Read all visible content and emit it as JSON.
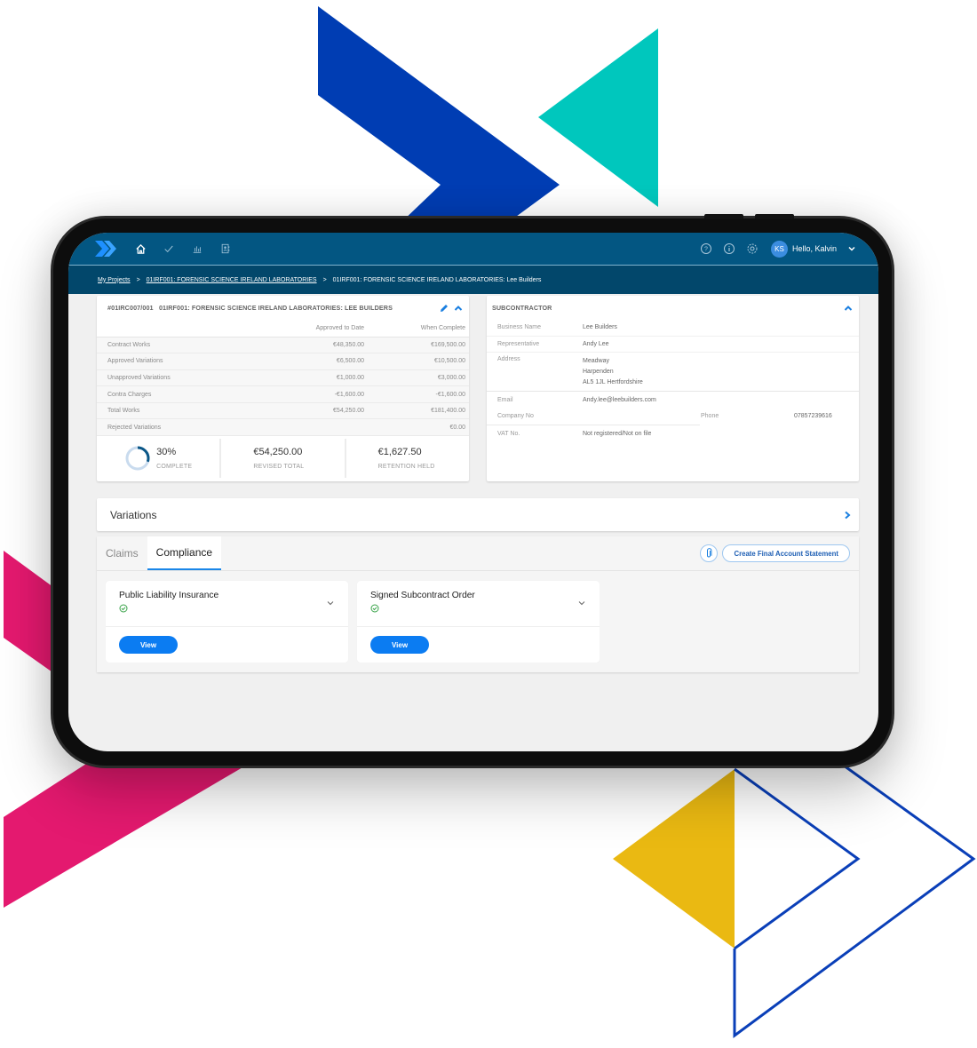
{
  "colors": {
    "topbar": "#035682",
    "breadcrumb_bg": "#02476b",
    "accent": "#1a86e8",
    "button": "#0b7cf2",
    "success": "#3aa44a",
    "deco_blue": "#003db3",
    "deco_teal": "#00c7bd",
    "deco_pink": "#e4196f",
    "deco_yellow": "#eab912"
  },
  "topbar": {
    "logo": "double-chevron-logo",
    "nav_icons": [
      "home-icon",
      "check-icon",
      "bar-chart-icon",
      "contacts-icon"
    ],
    "right_icons": [
      "help-icon",
      "info-icon",
      "settings-icon"
    ],
    "avatar_initials": "KS",
    "greeting": "Hello, Kalvin"
  },
  "breadcrumb": {
    "items": [
      "My Projects",
      "01IRF001: FORENSIC SCIENCE IRELAND LABORATORIES",
      "01IRF001: FORENSIC SCIENCE IRELAND LABORATORIES: Lee Builders"
    ],
    "separator": ">"
  },
  "contract": {
    "title": "#01IRC007/001   01IRF001: FORENSIC SCIENCE IRELAND LABORATORIES: LEE BUILDERS",
    "columns": [
      "",
      "Approved to Date",
      "When Complete"
    ],
    "rows": [
      {
        "label": "Contract Works",
        "approved": "€48,350.00",
        "complete": "€169,500.00"
      },
      {
        "label": "Approved Variations",
        "approved": "€6,500.00",
        "complete": "€10,500.00"
      },
      {
        "label": "Unapproved Variations",
        "approved": "€1,000.00",
        "complete": "€3,000.00"
      },
      {
        "label": "Contra Charges",
        "approved": "-€1,600.00",
        "complete": "-€1,600.00"
      },
      {
        "label": "Total Works",
        "approved": "€54,250.00",
        "complete": "€181,400.00"
      },
      {
        "label": "Rejected Variations",
        "approved": "",
        "complete": "€0.00"
      }
    ],
    "stats": {
      "complete_percent": 30,
      "complete_label": "30%",
      "complete_caption": "COMPLETE",
      "revised_total": "€54,250.00",
      "revised_caption": "REVISED TOTAL",
      "retention": "€1,627.50",
      "retention_caption": "RETENTION HELD"
    }
  },
  "subcontractor": {
    "title": "SUBCONTRACTOR",
    "business_name_label": "Business Name",
    "business_name": "Lee Builders",
    "representative_label": "Representative",
    "representative": "Andy Lee",
    "address_label": "Address",
    "address": [
      "Meadway",
      "Harpenden",
      "AL5 1JL Hertfordshire"
    ],
    "email_label": "Email",
    "email": "Andy.lee@leebuilders.com",
    "company_no_label": "Company No",
    "company_no": "",
    "phone_label": "Phone",
    "phone": "07857239616",
    "vat_label": "VAT No.",
    "vat": "Not registered/Not on file"
  },
  "variations": {
    "label": "Variations"
  },
  "tabs": {
    "items": [
      "Claims",
      "Compliance"
    ],
    "active": "Compliance",
    "create_statement_label": "Create Final Account Statement"
  },
  "compliance": [
    {
      "title": "Public Liability Insurance",
      "status": "complete",
      "button": "View"
    },
    {
      "title": "Signed Subcontract Order",
      "status": "complete",
      "button": "View"
    }
  ]
}
